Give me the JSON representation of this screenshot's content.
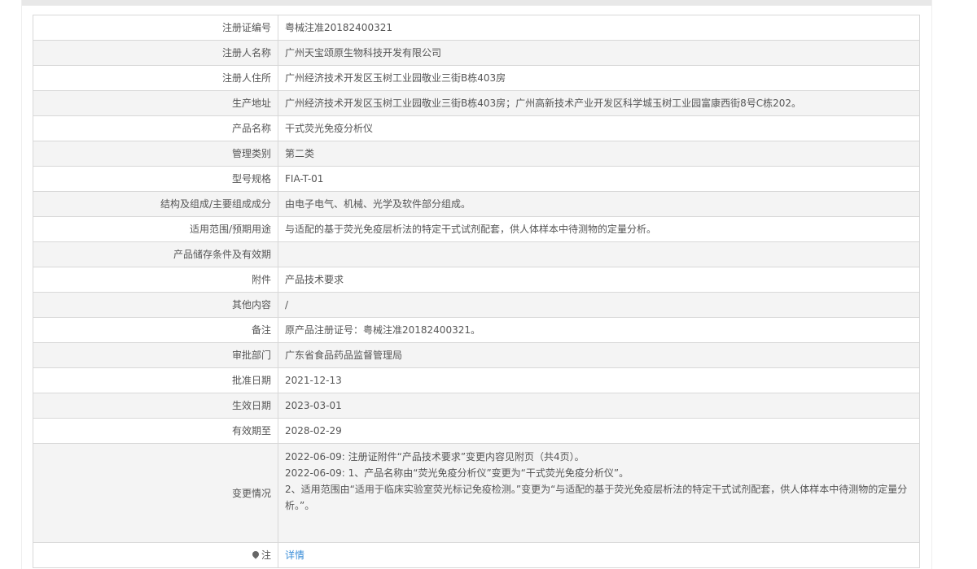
{
  "rows": [
    {
      "label": "注册证编号",
      "value": "粤械注准20182400321"
    },
    {
      "label": "注册人名称",
      "value": "广州天宝颂原生物科技开发有限公司"
    },
    {
      "label": "注册人住所",
      "value": "广州经济技术开发区玉树工业园敬业三街B栋403房"
    },
    {
      "label": "生产地址",
      "value": "广州经济技术开发区玉树工业园敬业三街B栋403房；广州高新技术产业开发区科学城玉树工业园富康西街8号C栋202。"
    },
    {
      "label": "产品名称",
      "value": "干式荧光免疫分析仪"
    },
    {
      "label": "管理类别",
      "value": "第二类"
    },
    {
      "label": "型号规格",
      "value": "FIA-T-01"
    },
    {
      "label": "结构及组成/主要组成成分",
      "value": "由电子电气、机械、光学及软件部分组成。"
    },
    {
      "label": "适用范围/预期用途",
      "value": "与适配的基于荧光免疫层析法的特定干式试剂配套，供人体样本中待测物的定量分析。"
    },
    {
      "label": "产品储存条件及有效期",
      "value": ""
    },
    {
      "label": "附件",
      "value": "产品技术要求"
    },
    {
      "label": "其他内容",
      "value": "/"
    },
    {
      "label": "备注",
      "value": "原产品注册证号：粤械注准20182400321。"
    },
    {
      "label": "审批部门",
      "value": "广东省食品药品监督管理局"
    },
    {
      "label": "批准日期",
      "value": "2021-12-13"
    },
    {
      "label": "生效日期",
      "value": "2023-03-01"
    },
    {
      "label": "有效期至",
      "value": "2028-02-29"
    }
  ],
  "changes": {
    "label": "变更情况",
    "lines": [
      "2022-06-09: 注册证附件“产品技术要求”变更内容见附页（共4页）。",
      "2022-06-09: 1、产品名称由“荧光免疫分析仪”变更为“干式荧光免疫分析仪”。",
      "2、适用范围由“适用于临床实验室荧光标记免疫检测。”变更为“与适配的基于荧光免疫层析法的特定干式试剂配套，供人体样本中待测物的定量分析。”。"
    ]
  },
  "note": {
    "label": "注",
    "link": "详情",
    "icon": "pin-icon"
  }
}
